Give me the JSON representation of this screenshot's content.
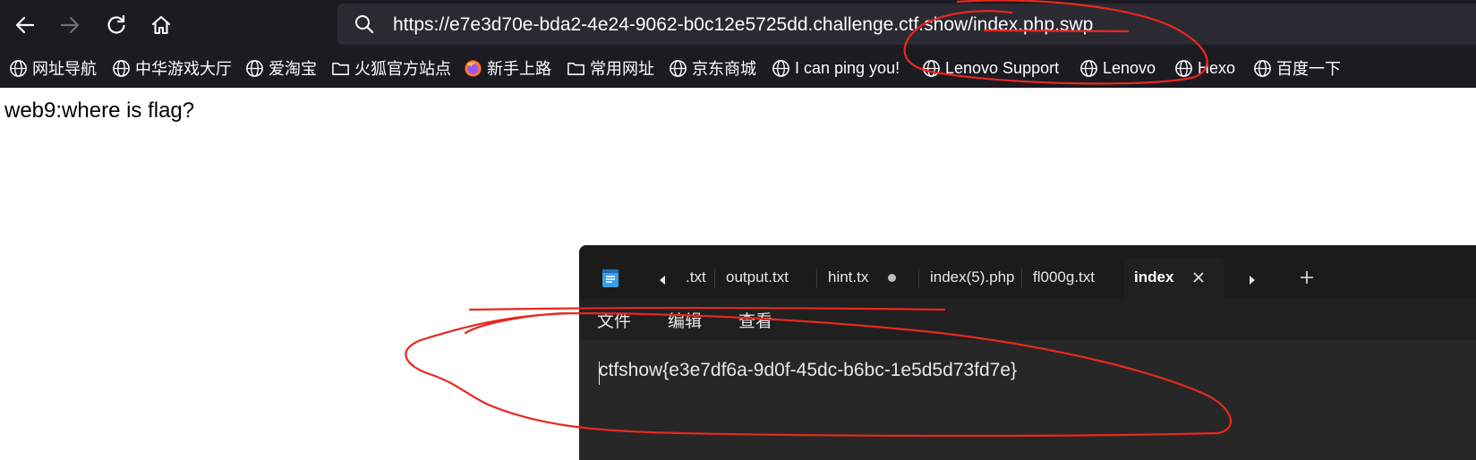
{
  "browser": {
    "url": "https://e7e3d70e-bda2-4e24-9062-b0c12e5725dd.challenge.ctf.show/index.php.swp",
    "nav_icons": [
      "back-arrow-icon",
      "forward-arrow-icon",
      "reload-icon",
      "home-icon"
    ]
  },
  "bookmarks": [
    {
      "label": "网址导航",
      "icon": "globe-icon"
    },
    {
      "label": "中华游戏大厅",
      "icon": "globe-icon"
    },
    {
      "label": "爱淘宝",
      "icon": "globe-icon"
    },
    {
      "label": "火狐官方站点",
      "icon": "folder-icon"
    },
    {
      "label": "新手上路",
      "icon": "firefox-icon"
    },
    {
      "label": "常用网址",
      "icon": "folder-icon"
    },
    {
      "label": "京东商城",
      "icon": "globe-icon"
    },
    {
      "label": "I can ping you!",
      "icon": "globe-icon"
    },
    {
      "label": "Lenovo Support",
      "icon": "globe-icon"
    },
    {
      "label": "Lenovo",
      "icon": "globe-icon"
    },
    {
      "label": "Hexo",
      "icon": "globe-icon"
    },
    {
      "label": "百度一下",
      "icon": "globe-icon"
    }
  ],
  "page": {
    "text": "web9:where is flag?"
  },
  "notepad": {
    "tabs": [
      {
        "label": ".txt",
        "active": false
      },
      {
        "label": "output.txt",
        "active": false
      },
      {
        "label": "hint.tx",
        "active": false,
        "unsaved": true
      },
      {
        "label": "index(5).php",
        "active": false
      },
      {
        "label": "fl000g.txt",
        "active": false
      },
      {
        "label": "index",
        "active": true
      }
    ],
    "menu": [
      "文件",
      "编辑",
      "查看"
    ],
    "content": "ctfshow{e3e7df6a-9d0f-45dc-b6bc-1e5d5d73fd7e}"
  },
  "colors": {
    "toolbar_bg": "#1c1b22",
    "urlbar_bg": "#2b2a33",
    "notepad_bg": "#202020",
    "annotation_red": "#e8281e"
  }
}
